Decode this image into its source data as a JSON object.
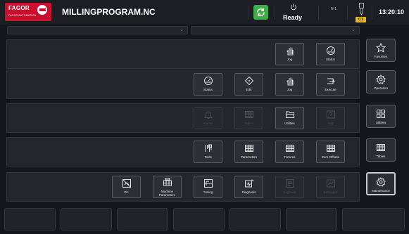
{
  "header": {
    "brand": "FAGOR",
    "brand_sub": "FAGOR AUTOMATION",
    "program_name": "MILLINGPROGRAM.NC",
    "status": "Ready",
    "channel": "N-1",
    "tool": "C1",
    "time": "13:20:10"
  },
  "rows": [
    {
      "buttons": [
        {
          "label": "Jog",
          "icon": "hand-icon",
          "enabled": true
        },
        {
          "label": "Status",
          "icon": "gauge-icon",
          "enabled": true
        }
      ]
    },
    {
      "buttons": [
        {
          "label": "Status",
          "icon": "gauge-icon",
          "enabled": true
        },
        {
          "label": "Edit",
          "icon": "edit-diamond-icon",
          "enabled": true
        },
        {
          "label": "Jog",
          "icon": "hand-icon",
          "enabled": true
        },
        {
          "label": "Execute",
          "icon": "execute-icon",
          "enabled": true
        }
      ]
    },
    {
      "buttons": [
        {
          "label": "Alarms",
          "icon": "bell-icon",
          "enabled": false
        },
        {
          "label": "Tables",
          "icon": "table-icon",
          "enabled": false
        },
        {
          "label": "Utilities",
          "icon": "folder-icon",
          "enabled": true
        },
        {
          "label": "Help",
          "icon": "help-icon",
          "enabled": false
        }
      ]
    },
    {
      "buttons": [
        {
          "label": "Tools",
          "icon": "tools-icon",
          "enabled": true
        },
        {
          "label": "Parameters",
          "icon": "table-icon",
          "enabled": true
        },
        {
          "label": "Fixtures",
          "icon": "table-icon",
          "enabled": true
        },
        {
          "label": "Zero Offsets",
          "icon": "table-icon",
          "enabled": true
        }
      ]
    },
    {
      "buttons": [
        {
          "label": "Plc",
          "icon": "plc-icon",
          "enabled": true
        },
        {
          "label": "Machine Parameters",
          "icon": "machine-params-icon",
          "enabled": true
        },
        {
          "label": "Tuning",
          "icon": "tuning-icon",
          "enabled": true
        },
        {
          "label": "Diagnosis",
          "icon": "diagnosis-icon",
          "enabled": true
        },
        {
          "label": "Logbook",
          "icon": "logbook-icon",
          "enabled": false
        },
        {
          "label": "Debugger",
          "icon": "debugger-icon",
          "enabled": false
        }
      ]
    }
  ],
  "sidebar": [
    {
      "label": "Favorites",
      "icon": "star-icon",
      "active": false
    },
    {
      "label": "Operation",
      "icon": "gear-icon",
      "active": false
    },
    {
      "label": "Utilities",
      "icon": "grid-icon",
      "active": false
    },
    {
      "label": "Tables",
      "icon": "table-icon",
      "active": false
    },
    {
      "label": "Maintenance",
      "icon": "gear-icon",
      "active": true
    }
  ]
}
